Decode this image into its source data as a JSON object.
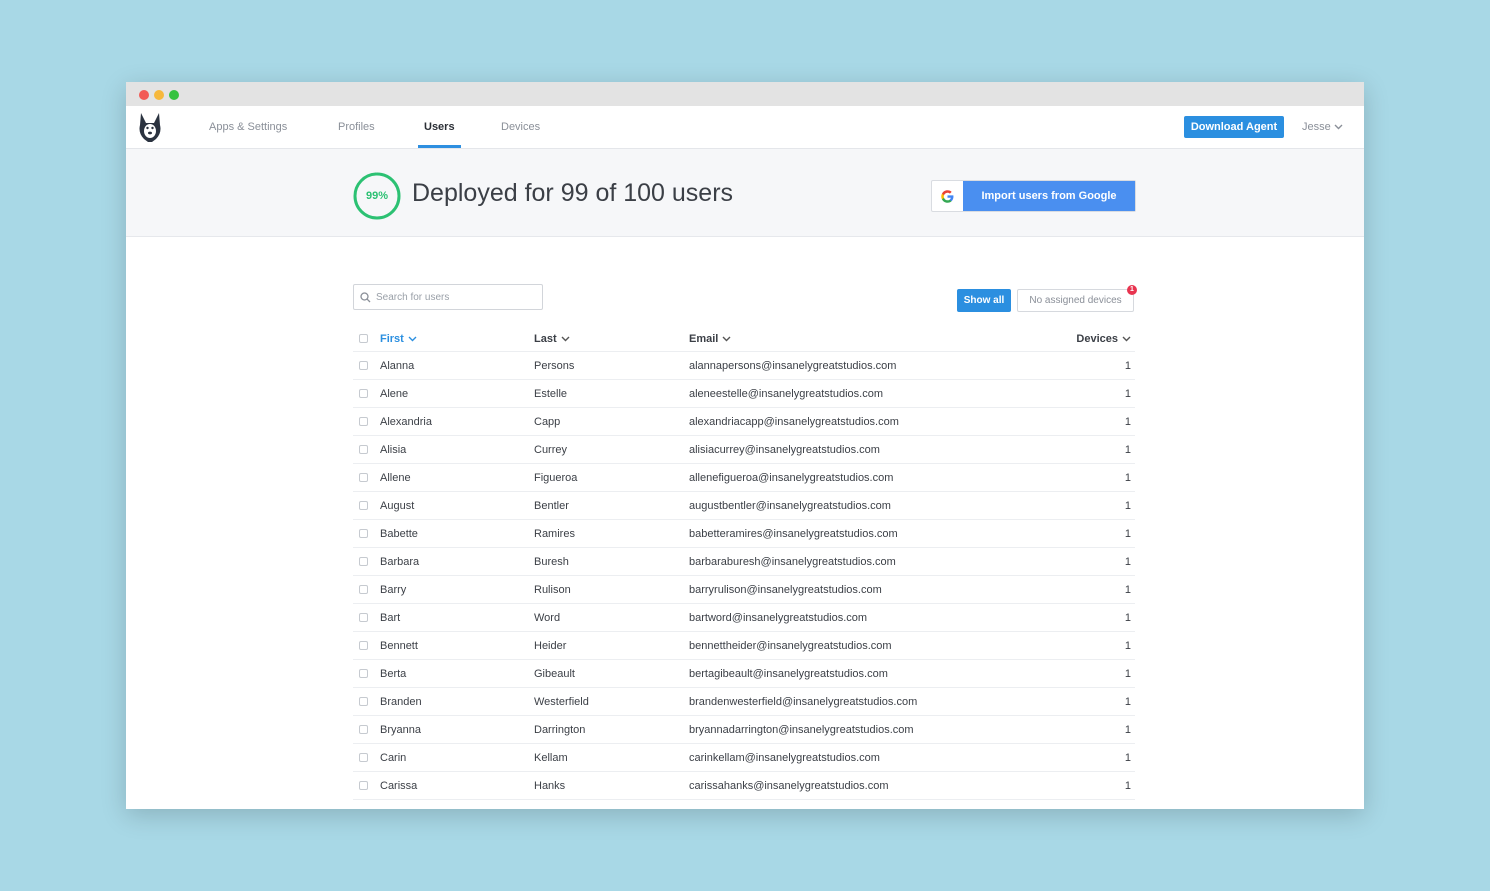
{
  "nav": {
    "tabs": [
      {
        "label": "Apps & Settings"
      },
      {
        "label": "Profiles"
      },
      {
        "label": "Users"
      },
      {
        "label": "Devices"
      }
    ],
    "download_label": "Download Agent",
    "user_name": "Jesse"
  },
  "hero": {
    "percent_label": "99%",
    "percent": 99,
    "title": "Deployed for 99 of 100 users",
    "import_label": "Import users from Google"
  },
  "search": {
    "placeholder": "Search for users"
  },
  "filters": {
    "show_all": "Show all",
    "no_assigned": "No assigned devices",
    "badge_count": "1"
  },
  "table": {
    "columns": {
      "first": "First",
      "last": "Last",
      "email": "Email",
      "devices": "Devices"
    },
    "rows": [
      {
        "first": "Alanna",
        "last": "Persons",
        "email": "alannapersons@insanelygreatstudios.com",
        "devices": "1"
      },
      {
        "first": "Alene",
        "last": "Estelle",
        "email": "aleneestelle@insanelygreatstudios.com",
        "devices": "1"
      },
      {
        "first": "Alexandria",
        "last": "Capp",
        "email": "alexandriacapp@insanelygreatstudios.com",
        "devices": "1"
      },
      {
        "first": "Alisia",
        "last": "Currey",
        "email": "alisiacurrey@insanelygreatstudios.com",
        "devices": "1"
      },
      {
        "first": "Allene",
        "last": "Figueroa",
        "email": "allenefigueroa@insanelygreatstudios.com",
        "devices": "1"
      },
      {
        "first": "August",
        "last": "Bentler",
        "email": "augustbentler@insanelygreatstudios.com",
        "devices": "1"
      },
      {
        "first": "Babette",
        "last": "Ramires",
        "email": "babetteramires@insanelygreatstudios.com",
        "devices": "1"
      },
      {
        "first": "Barbara",
        "last": "Buresh",
        "email": "barbaraburesh@insanelygreatstudios.com",
        "devices": "1"
      },
      {
        "first": "Barry",
        "last": "Rulison",
        "email": "barryrulison@insanelygreatstudios.com",
        "devices": "1"
      },
      {
        "first": "Bart",
        "last": "Word",
        "email": "bartword@insanelygreatstudios.com",
        "devices": "1"
      },
      {
        "first": "Bennett",
        "last": "Heider",
        "email": "bennettheider@insanelygreatstudios.com",
        "devices": "1"
      },
      {
        "first": "Berta",
        "last": "Gibeault",
        "email": "bertagibeault@insanelygreatstudios.com",
        "devices": "1"
      },
      {
        "first": "Branden",
        "last": "Westerfield",
        "email": "brandenwesterfield@insanelygreatstudios.com",
        "devices": "1"
      },
      {
        "first": "Bryanna",
        "last": "Darrington",
        "email": "bryannadarrington@insanelygreatstudios.com",
        "devices": "1"
      },
      {
        "first": "Carin",
        "last": "Kellam",
        "email": "carinkellam@insanelygreatstudios.com",
        "devices": "1"
      },
      {
        "first": "Carissa",
        "last": "Hanks",
        "email": "carissahanks@insanelygreatstudios.com",
        "devices": "1"
      }
    ]
  },
  "colors": {
    "accent": "#2b8fe0",
    "success": "#2cc173",
    "google_blue": "#4a8ff0",
    "badge_red": "#e8344f",
    "background": "#a8d8e6"
  }
}
